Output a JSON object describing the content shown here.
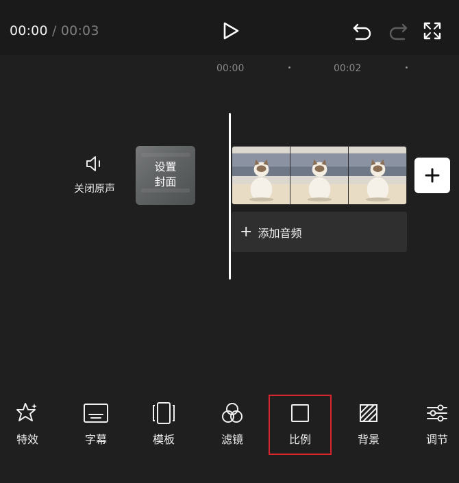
{
  "player": {
    "current_time": "00:00",
    "separator": "/",
    "total_time": "00:03",
    "icons": [
      "play-icon",
      "undo-icon",
      "redo-icon",
      "fullscreen-icon"
    ]
  },
  "ruler": {
    "labels": [
      "00:00",
      "00:02"
    ]
  },
  "track": {
    "mute_label": "关闭原声",
    "cover_line1": "设置",
    "cover_line2": "封面",
    "add_audio_plus": "+",
    "add_audio_label": "添加音频"
  },
  "toolbar": {
    "items": [
      {
        "label": "特效",
        "icon": "effects-star-icon"
      },
      {
        "label": "字幕",
        "icon": "subtitle-icon"
      },
      {
        "label": "模板",
        "icon": "template-icon"
      },
      {
        "label": "滤镜",
        "icon": "filter-icon"
      },
      {
        "label": "比例",
        "icon": "ratio-icon"
      },
      {
        "label": "背景",
        "icon": "background-icon"
      },
      {
        "label": "调节",
        "icon": "adjust-icon"
      }
    ],
    "selected_label": "比例"
  },
  "colors": {
    "background": "#1f1f1f",
    "topbar": "#1a1a1a",
    "audio_track": "#2f2f2f",
    "highlight": "#d9262c"
  }
}
